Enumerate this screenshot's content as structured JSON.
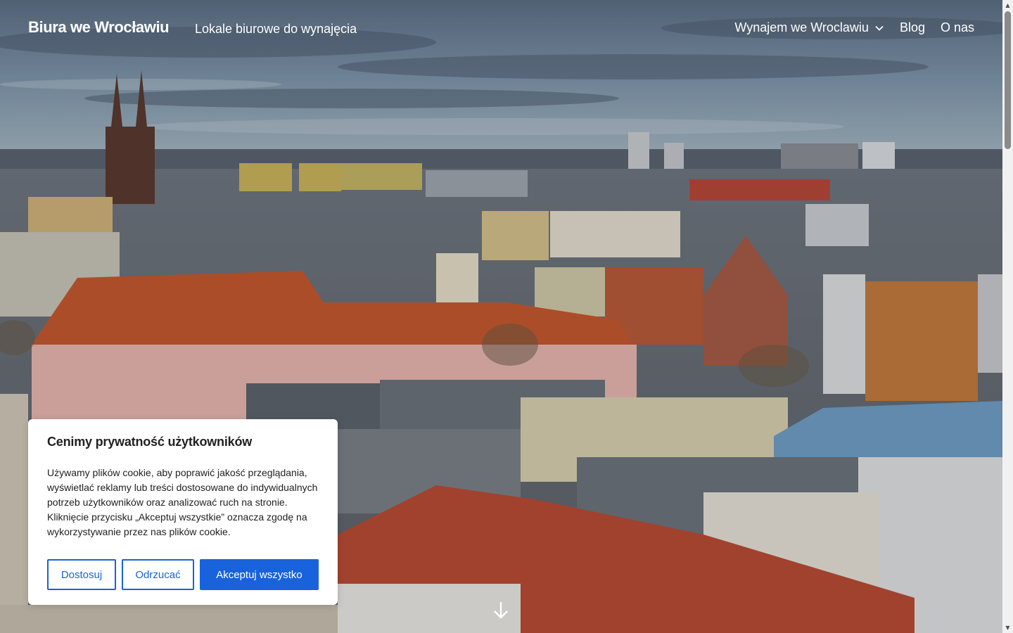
{
  "header": {
    "site_title": "Biura we Wrocławiu",
    "tagline": "Lokale biurowe do wynajęcia",
    "nav": [
      {
        "label": "Wynajem we Wroclawiu",
        "has_dropdown": true
      },
      {
        "label": "Blog",
        "has_dropdown": false
      },
      {
        "label": "O nas",
        "has_dropdown": false
      }
    ]
  },
  "hero": {
    "image": "Wrocław city skyline with cathedral towers and red-roofed buildings",
    "scroll_icon": "arrow-down-icon"
  },
  "cookie_banner": {
    "title": "Cenimy prywatność użytkowników",
    "text": "Używamy plików cookie, aby poprawić jakość przeglądania, wyświetlać reklamy lub treści dostosowane do indywidualnych potrzeb użytkowników oraz analizować ruch na stronie. Kliknięcie przycisku „Akceptuj wszystkie” oznacza zgodę na wykorzystywanie przez nas plików cookie.",
    "buttons": {
      "customize": "Dostosuj",
      "reject": "Odrzucać",
      "accept": "Akceptuj wszystko"
    }
  },
  "colors": {
    "accent": "#1863dc",
    "header_text": "#ffffff",
    "banner_bg": "#ffffff",
    "banner_text": "#212121"
  }
}
